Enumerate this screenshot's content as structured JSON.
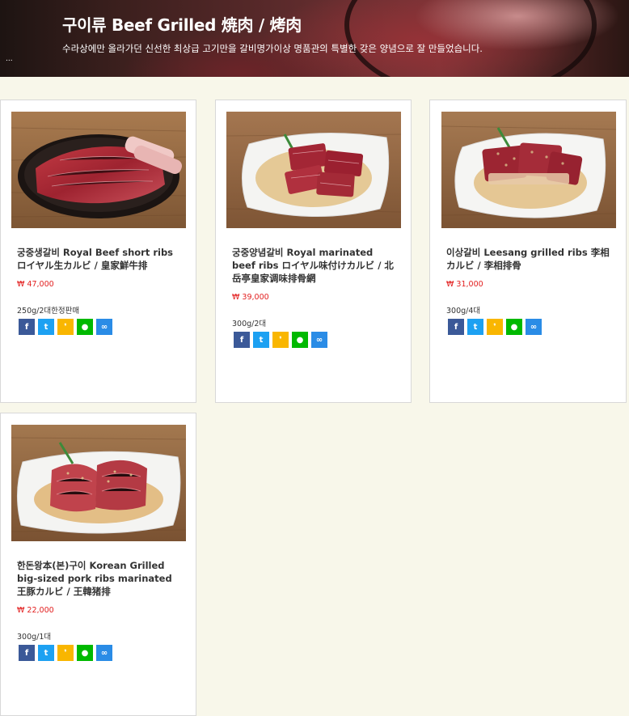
{
  "header": {
    "title": "구이류 Beef Grilled 焼肉 / 烤肉",
    "subtitle": "수라상에만 올라가던 신선한 최상급 고기만을 갈비명가이상 명품관의 특별한 갖은 양념으로 잘 만들었습니다.",
    "ellipsis": "..."
  },
  "products": [
    {
      "name": "궁중생갈비 Royal Beef short ribs ロイヤル生カルビ / 皇家鮮牛排",
      "price": "₩ 47,000",
      "meta": "250g/2대한정판매"
    },
    {
      "name": "궁중양념갈비 Royal marinated beef ribs ロイヤル味付けカルビ / 北岳亭皇家调味排骨網",
      "price": "₩ 39,000",
      "meta": "300g/2대"
    },
    {
      "name": "이상갈비 Leesang grilled ribs 李相カルビ / 李相排骨",
      "price": "₩ 31,000",
      "meta": "300g/4대"
    },
    {
      "name": "한돈왕本(본)구이 Korean Grilled big-sized pork ribs marinated 王豚カルビ / 王韓猪排",
      "price": "₩ 22,000",
      "meta": "300g/1대"
    }
  ],
  "share_icons": [
    {
      "name": "facebook",
      "glyph": "f",
      "color": "#3b5998"
    },
    {
      "name": "twitter",
      "glyph": "t",
      "color": "#1da1f2"
    },
    {
      "name": "kakaostory",
      "glyph": "❜",
      "color": "#f9b600"
    },
    {
      "name": "line",
      "glyph": "●",
      "color": "#00b900"
    },
    {
      "name": "link",
      "glyph": "∞",
      "color": "#2a8ce6"
    }
  ],
  "colors": {
    "background": "#f8f7ea",
    "price": "#e21d1d"
  }
}
